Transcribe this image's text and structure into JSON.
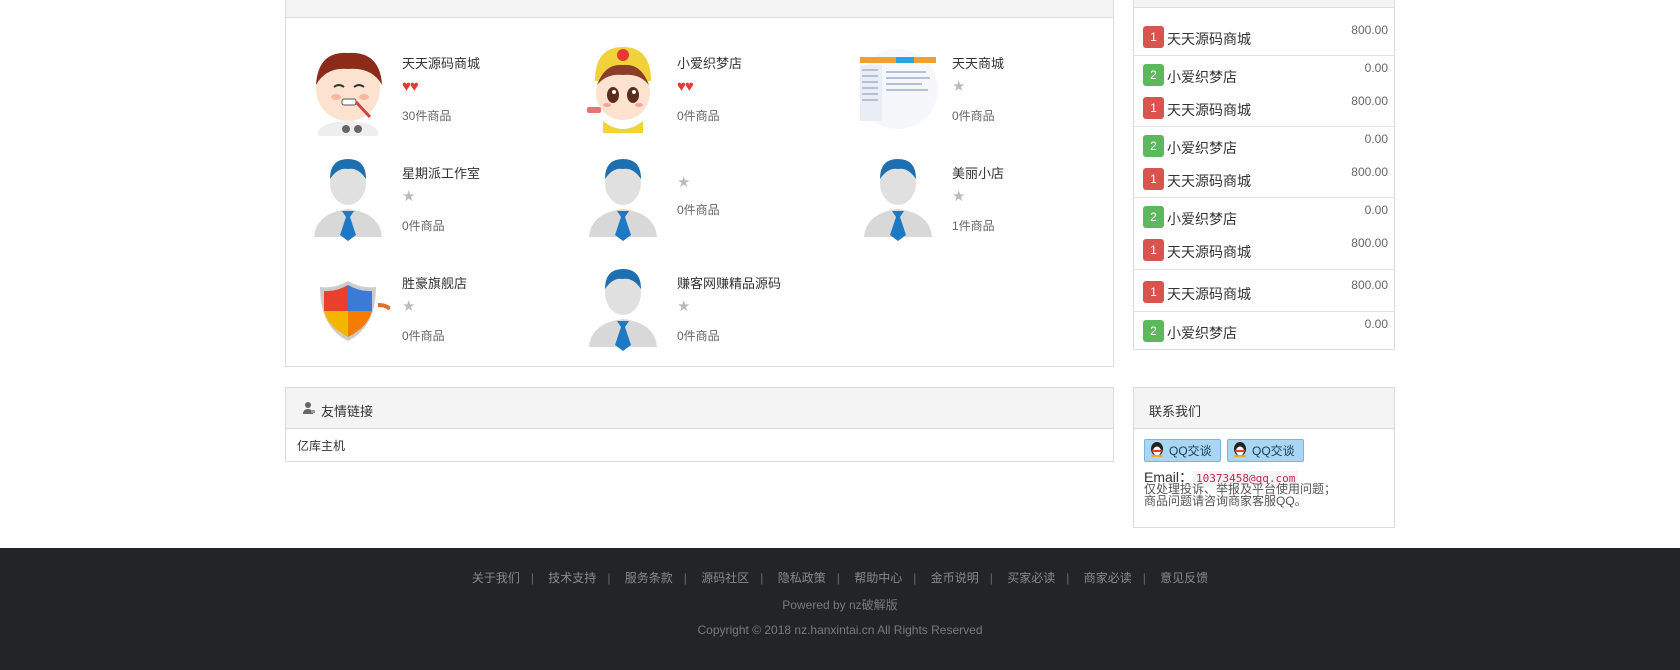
{
  "shops": [
    {
      "name": "天天源码商城",
      "rating": "♥♥",
      "rating_kind": "hearts",
      "count": "30件商品",
      "logo": "boy-avatar"
    },
    {
      "name": "小爱织梦店",
      "rating": "♥♥",
      "rating_kind": "hearts",
      "count": "0件商品",
      "logo": "girl-avatar"
    },
    {
      "name": "天天商城",
      "rating": "★",
      "rating_kind": "star",
      "count": "0件商品",
      "logo": "screenshot-thumb"
    },
    {
      "name": "星期派工作室",
      "rating": "★",
      "rating_kind": "star",
      "count": "0件商品",
      "logo": "default-user"
    },
    {
      "name": "",
      "rating": "★",
      "rating_kind": "star",
      "count": "0件商品",
      "logo": "default-user"
    },
    {
      "name": "美丽小店",
      "rating": "★",
      "rating_kind": "star",
      "count": "1件商品",
      "logo": "default-user"
    },
    {
      "name": "胜豪旗舰店",
      "rating": "★",
      "rating_kind": "star",
      "count": "0件商品",
      "logo": "shield-logo"
    },
    {
      "name": "赚客网赚精品源码",
      "rating": "★",
      "rating_kind": "star",
      "count": "0件商品",
      "logo": "default-user"
    }
  ],
  "ranking": [
    {
      "rank": "1",
      "name": "天天源码商城",
      "value": "800.00",
      "color": "#d9534f"
    },
    {
      "rank": "2",
      "name": "小爱织梦店",
      "value": "0.00",
      "color": "#5cb85c"
    },
    {
      "rank": "1",
      "name": "天天源码商城",
      "value": "800.00",
      "color": "#d9534f"
    },
    {
      "rank": "2",
      "name": "小爱织梦店",
      "value": "0.00",
      "color": "#5cb85c"
    },
    {
      "rank": "1",
      "name": "天天源码商城",
      "value": "800.00",
      "color": "#d9534f"
    },
    {
      "rank": "2",
      "name": "小爱织梦店",
      "value": "0.00",
      "color": "#5cb85c"
    },
    {
      "rank": "1",
      "name": "天天源码商城",
      "value": "800.00",
      "color": "#d9534f"
    },
    {
      "rank": "1",
      "name": "天天源码商城",
      "value": "800.00",
      "color": "#d9534f"
    },
    {
      "rank": "2",
      "name": "小爱织梦店",
      "value": "0.00",
      "color": "#5cb85c"
    }
  ],
  "friend_links": {
    "title": "友情链接",
    "items": [
      "亿库主机"
    ]
  },
  "contact": {
    "title": "联系我们",
    "qq_buttons": [
      "QQ交谈",
      "QQ交谈"
    ],
    "email_label": "Email：",
    "email": "10373458@qq.com",
    "notice_line1": "仅处理投诉、举报及平台使用问题；",
    "notice_line2": "商品问题请咨询商家客服QQ。"
  },
  "footer": {
    "nav": [
      "关于我们",
      "技术支持",
      "服务条款",
      "源码社区",
      "隐私政策",
      "帮助中心",
      "金币说明",
      "买家必读",
      "商家必读",
      "意见反馈"
    ],
    "powered": "Powered by nz破解版",
    "copyright": "Copyright © 2018 nz.hanxintai.cn All Rights Reserved"
  }
}
